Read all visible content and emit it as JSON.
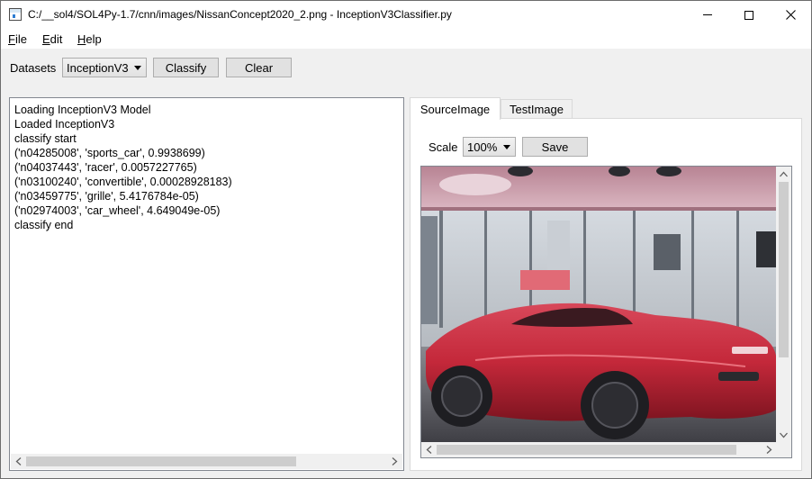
{
  "window": {
    "title": "C:/__sol4/SOL4Py-1.7/cnn/images/NissanConcept2020_2.png - InceptionV3Classifier.py"
  },
  "menu": {
    "items": [
      {
        "label": "File",
        "mnemonic": "F",
        "rest": "ile"
      },
      {
        "label": "Edit",
        "mnemonic": "E",
        "rest": "dit"
      },
      {
        "label": "Help",
        "mnemonic": "H",
        "rest": "elp"
      }
    ]
  },
  "toolbar": {
    "datasets_label": "Datasets",
    "dataset_selected": "InceptionV3",
    "classify_label": "Classify",
    "clear_label": "Clear"
  },
  "log": {
    "lines": [
      "Loading InceptionV3 Model",
      "Loaded InceptionV3",
      "classify start",
      "('n04285008', 'sports_car', 0.9938699)",
      "('n04037443', 'racer', 0.0057227765)",
      "('n03100240', 'convertible', 0.00028928183)",
      "('n03459775', 'grille', 5.4176784e-05)",
      "('n02974003', 'car_wheel', 4.649049e-05)",
      "classify end"
    ]
  },
  "tabs": {
    "source_label": "SourceImage",
    "test_label": "TestImage"
  },
  "image_panel": {
    "scale_label": "Scale",
    "scale_selected": "100%",
    "save_label": "Save"
  },
  "colors": {
    "car_red": "#c4283a",
    "ceiling_pink": "#c89aa6",
    "floor": "#4a4a4e"
  }
}
